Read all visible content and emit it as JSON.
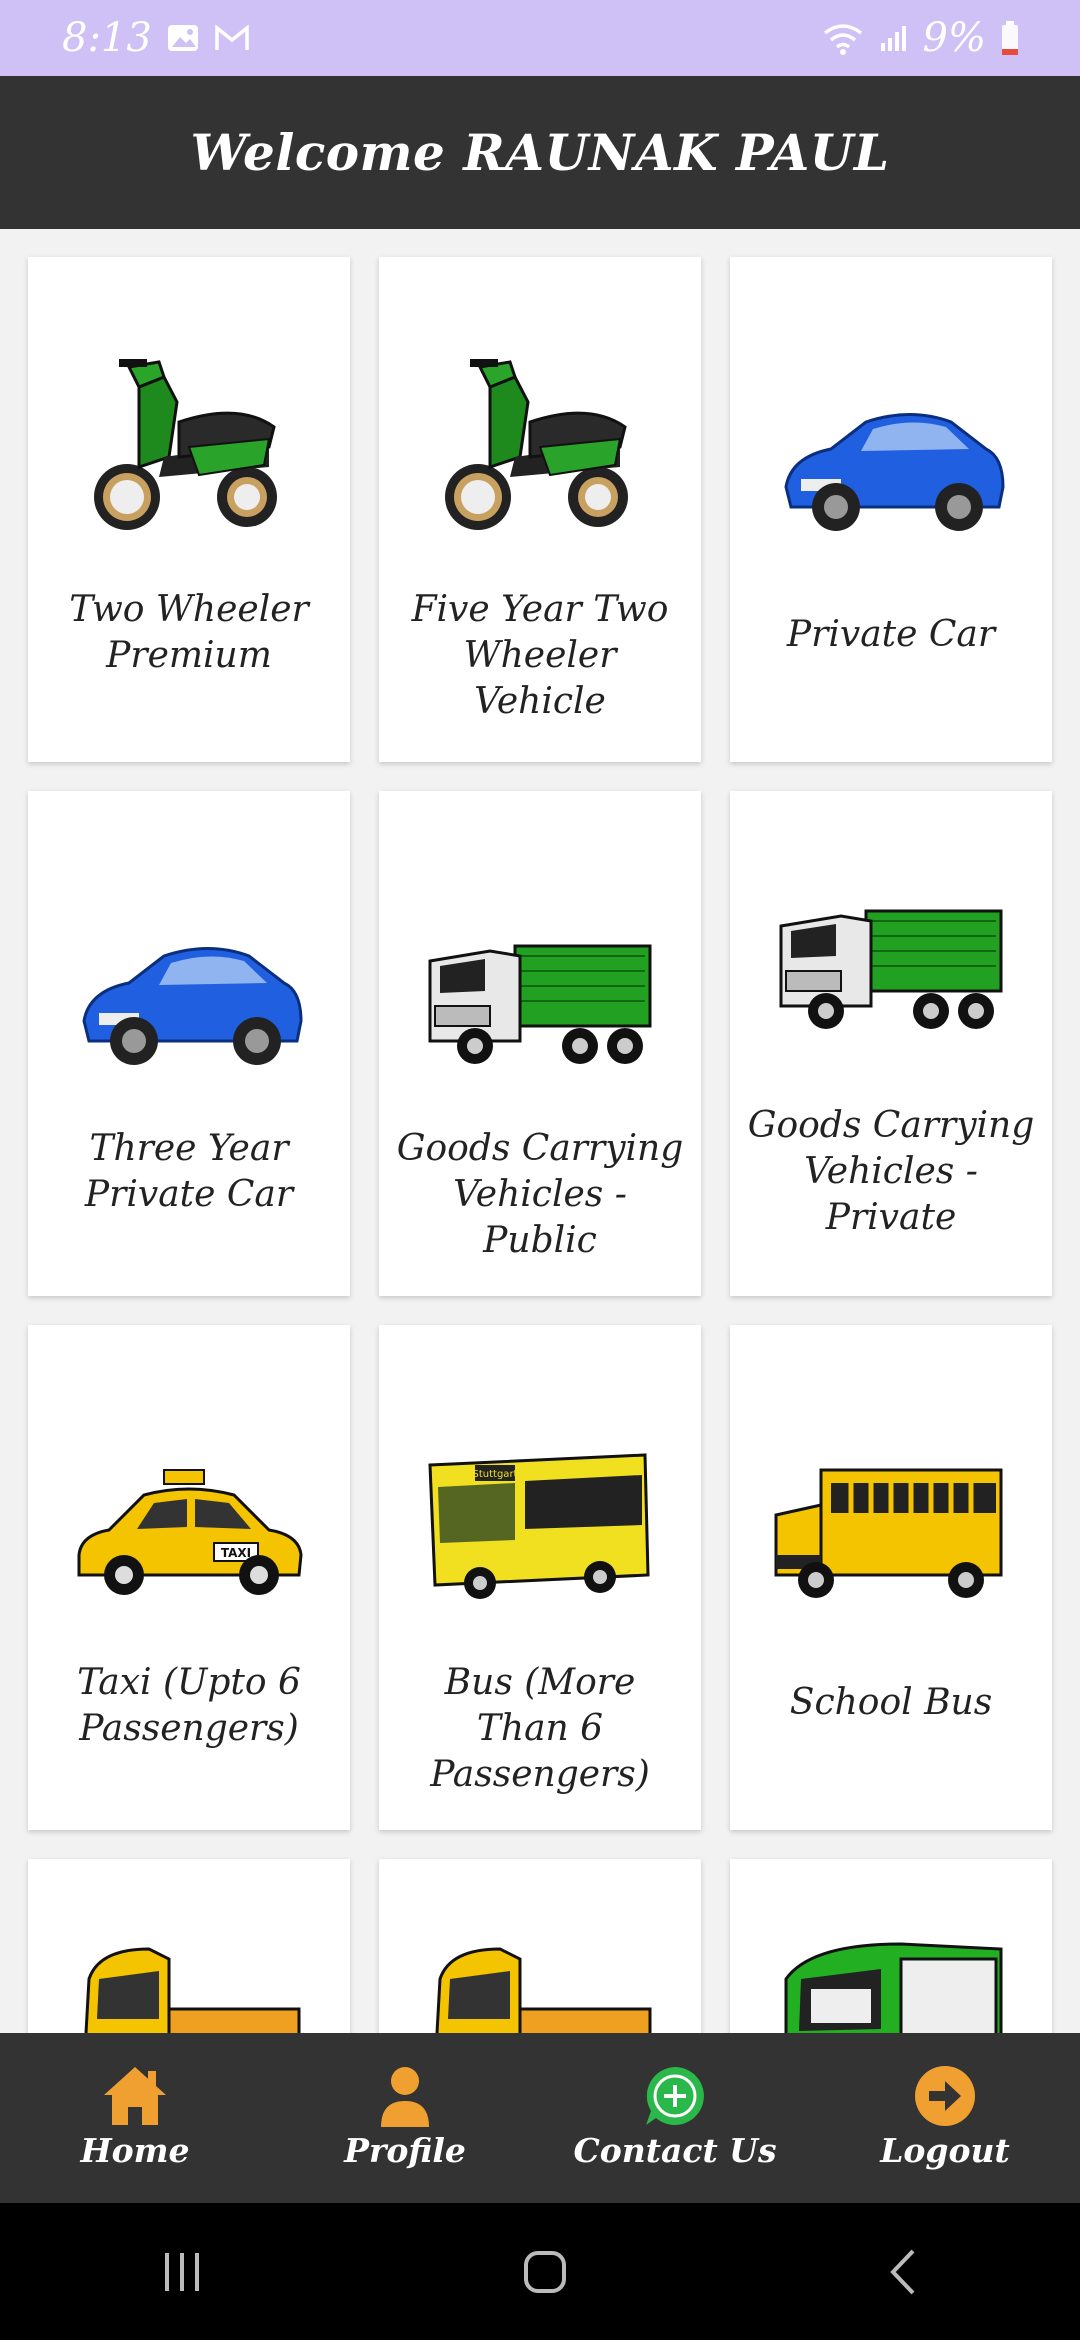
{
  "status_bar": {
    "time": "8:13",
    "battery": "9%",
    "icons": [
      "gallery-icon",
      "gmail-icon",
      "wifi-icon",
      "signal-icon",
      "battery-icon"
    ]
  },
  "header": {
    "title": "Welcome RAUNAK PAUL"
  },
  "colors": {
    "status_bar": "#cfc0f5",
    "app_bar": "#333333",
    "nav_accent": "#f0a030",
    "contact_green": "#2bb84a",
    "background": "#f2f2f2"
  },
  "vehicles": [
    {
      "label": "Two Wheeler Premium",
      "icon": "scooter-icon"
    },
    {
      "label": "Five Year Two Wheeler Vehicle",
      "icon": "scooter-icon"
    },
    {
      "label": "Private Car",
      "icon": "car-icon"
    },
    {
      "label": "Three Year Private Car",
      "icon": "car-icon"
    },
    {
      "label": "Goods Carrying Vehicles - Public",
      "icon": "truck-icon"
    },
    {
      "label": "Goods Carrying Vehicles - Private",
      "icon": "truck-icon"
    },
    {
      "label": "Taxi (Upto 6 Passengers)",
      "icon": "taxi-icon",
      "sign": "TAXI"
    },
    {
      "label": "Bus (More Than 6 Passengers)",
      "icon": "bus-icon",
      "sign": "Stuttgart"
    },
    {
      "label": "School Bus",
      "icon": "school-bus-icon"
    },
    {
      "label": "",
      "icon": "cargo-rickshaw-icon"
    },
    {
      "label": "",
      "icon": "cargo-rickshaw-icon"
    },
    {
      "label": "",
      "icon": "auto-rickshaw-icon"
    }
  ],
  "bottom_nav": [
    {
      "label": "Home",
      "icon": "home-icon"
    },
    {
      "label": "Profile",
      "icon": "person-icon"
    },
    {
      "label": "Contact Us",
      "icon": "whatsapp-icon"
    },
    {
      "label": "Logout",
      "icon": "logout-icon"
    }
  ],
  "system_nav": [
    "recents-icon",
    "home-circle-icon",
    "back-icon"
  ]
}
